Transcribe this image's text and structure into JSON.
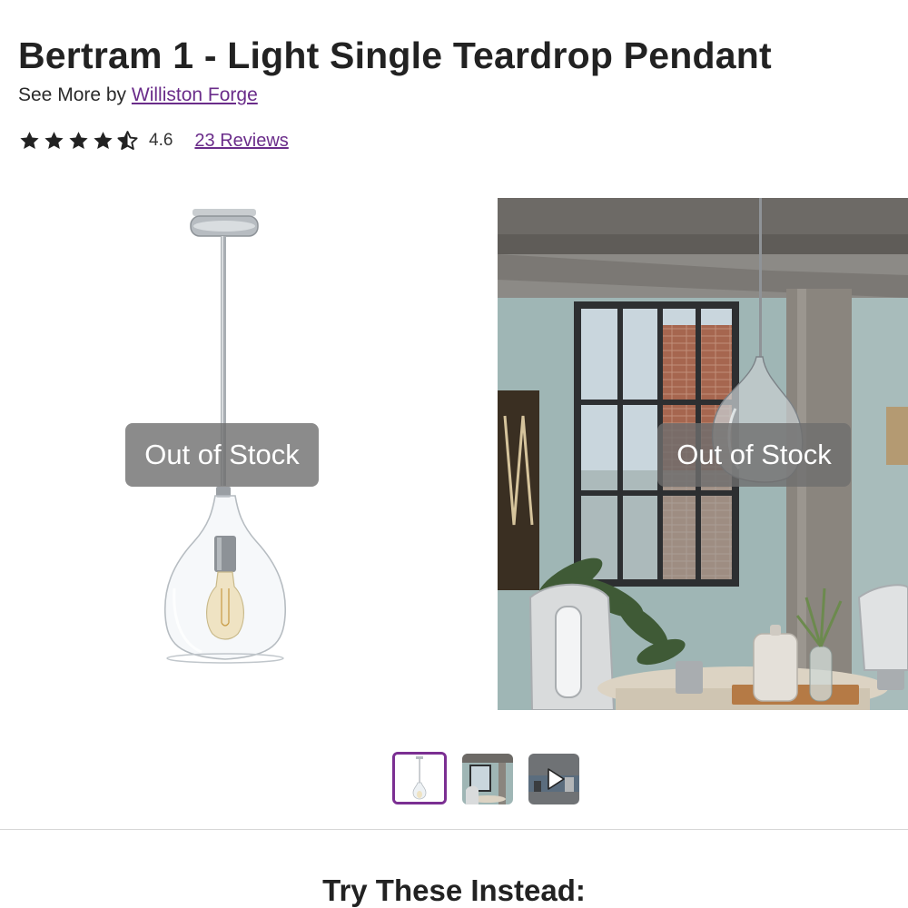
{
  "product": {
    "title": "Bertram 1 - Light Single Teardrop Pendant",
    "byline_prefix": "See More by",
    "brand": "Williston Forge",
    "rating_value": "4.6",
    "rating_stars": 4.6,
    "reviews_link": "23 Reviews"
  },
  "gallery": {
    "slides": [
      {
        "overlay": "Out of Stock",
        "image": "pendant-light-product-photo"
      },
      {
        "overlay": "Out of Stock",
        "image": "pendant-light-room-scene-photo"
      }
    ],
    "thumbnails": [
      {
        "image": "pendant-light-thumbnail",
        "active": true
      },
      {
        "image": "room-scene-thumbnail",
        "active": false
      },
      {
        "image": "video-thumbnail",
        "icon": "play-icon",
        "active": false
      }
    ],
    "accent_color": "#7b2f92"
  },
  "section": {
    "heading": "Try These Instead:"
  },
  "colors": {
    "link": "#6a2c8a",
    "star": "#222222",
    "overlay": "#6e6e6e"
  }
}
